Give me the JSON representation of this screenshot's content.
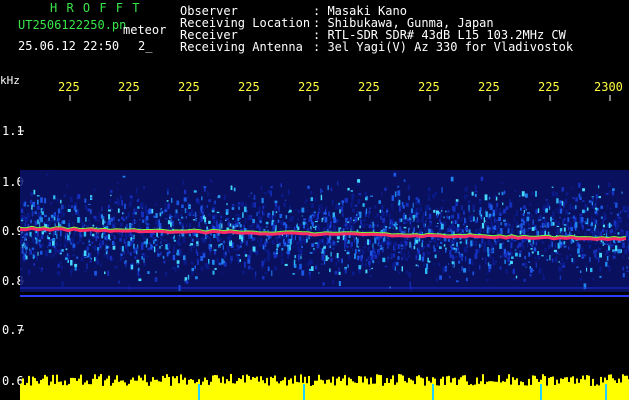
{
  "header": {
    "brand": "H R O F F T",
    "filename": "UT2506122250.pn",
    "mode": "meteor",
    "timestamp": "25.06.12 22:50",
    "frame": "2_",
    "info": [
      {
        "label": "Observer",
        "value": ": Masaki Kano"
      },
      {
        "label": "Receiving Location",
        "value": ": Shibukawa, Gunma, Japan"
      },
      {
        "label": "Receiver",
        "value": ": RTL-SDR SDR# 43dB L15 103.2MHz CW"
      },
      {
        "label": "Receiving Antenna",
        "value": ": 3el Yagi(V) Az 330 for Vladivostok"
      }
    ]
  },
  "axis": {
    "unit": "kHz",
    "y_ticks": [
      "1.1",
      "1.0",
      "0.9",
      "0.8",
      "0.7",
      "0.6"
    ],
    "x_ticks": [
      "225",
      "225",
      "225",
      "225",
      "225",
      "225",
      "225",
      "225",
      "225",
      "2300"
    ]
  },
  "colors": {
    "signal_trace": "#ff2a6a",
    "meteor_band": "#22d0ff",
    "noise_floor": "#ffff00"
  }
}
